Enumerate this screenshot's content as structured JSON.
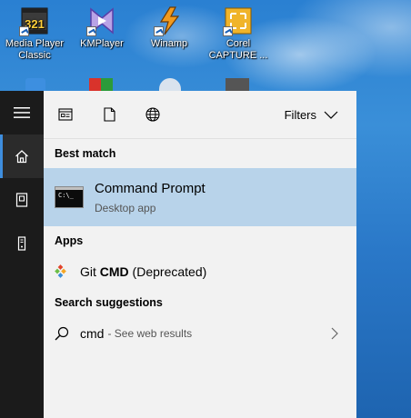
{
  "desktop": {
    "icons": [
      {
        "label": "Media Player Classic",
        "icon": "media-player-classic-icon"
      },
      {
        "label": "KMPlayer",
        "icon": "kmplayer-icon"
      },
      {
        "label": "Winamp",
        "icon": "winamp-icon"
      },
      {
        "label": "Corel CAPTURE ...",
        "icon": "corel-capture-icon"
      }
    ]
  },
  "sidebar": {
    "items": [
      {
        "name": "menu",
        "icon": "hamburger-icon"
      },
      {
        "name": "home",
        "icon": "home-icon",
        "active": true
      },
      {
        "name": "documents",
        "icon": "document-icon"
      },
      {
        "name": "tower",
        "icon": "tower-icon"
      }
    ]
  },
  "toolbar": {
    "tabs": [
      {
        "name": "apps",
        "icon": "apps-window-icon"
      },
      {
        "name": "documents",
        "icon": "document-icon"
      },
      {
        "name": "web",
        "icon": "globe-icon"
      }
    ],
    "filters_label": "Filters"
  },
  "results": {
    "best_match_header": "Best match",
    "best_match": {
      "title": "Command Prompt",
      "subtitle": "Desktop app"
    },
    "apps_header": "Apps",
    "apps": [
      {
        "prefix": "Git ",
        "bold": "CMD",
        "suffix": " (Deprecated)"
      }
    ],
    "suggestions_header": "Search suggestions",
    "suggestions": [
      {
        "query": "cmd",
        "hint": "- See web results"
      }
    ]
  },
  "colors": {
    "sidebar": "#1b1b1b",
    "panel": "#f2f2f2",
    "highlight": "#b8d3ea",
    "accent": "#3e8ede"
  }
}
